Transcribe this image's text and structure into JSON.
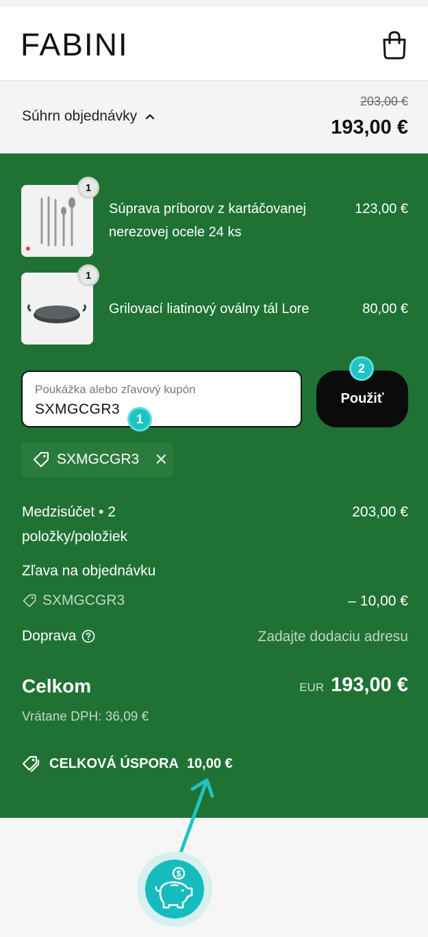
{
  "header": {
    "logo": "FABINI",
    "cart_icon": "shopping-bag-icon"
  },
  "summary": {
    "toggle_label": "Súhrn objednávky",
    "original_price": "203,00 €",
    "price": "193,00 €"
  },
  "items": [
    {
      "name_line1": "Súprava príborov z kartáčovanej",
      "name_line2": "nerezovej ocele 24 ks",
      "quantity": "1",
      "price": "123,00 €"
    },
    {
      "name_line1": "Grilovací liatinový oválny tál Lore",
      "name_line2": "",
      "quantity": "1",
      "price": "80,00 €"
    }
  ],
  "coupon": {
    "placeholder": "Poukážka alebo zľavový kupón",
    "value": "SXMGCGR3",
    "apply_label": "Použiť",
    "applied_code": "SXMGCGR3",
    "remove_icon": "close-icon"
  },
  "steps": [
    "1",
    "2"
  ],
  "totals": {
    "subtotal_label_line1": "Medzisúčet • 2",
    "subtotal_label_line2": "položky/položiek",
    "subtotal_value": "203,00 €",
    "discount_label": "Zľava na objednávku",
    "discount_code": "SXMGCGR3",
    "discount_value": "– 10,00 €",
    "shipping_label": "Doprava",
    "shipping_value": "Zadajte dodaciu adresu",
    "total_label": "Celkom",
    "currency": "EUR",
    "total_value": "193,00 €",
    "vat_text": "Vrátane DPH: 36,09 €",
    "savings_label": "CELKOVÁ ÚSPORA",
    "savings_value": "10,00 €"
  },
  "colors": {
    "panel_green": "#1f7234",
    "accent_teal": "#1ec3c4",
    "button_black": "#0b0b0b"
  }
}
